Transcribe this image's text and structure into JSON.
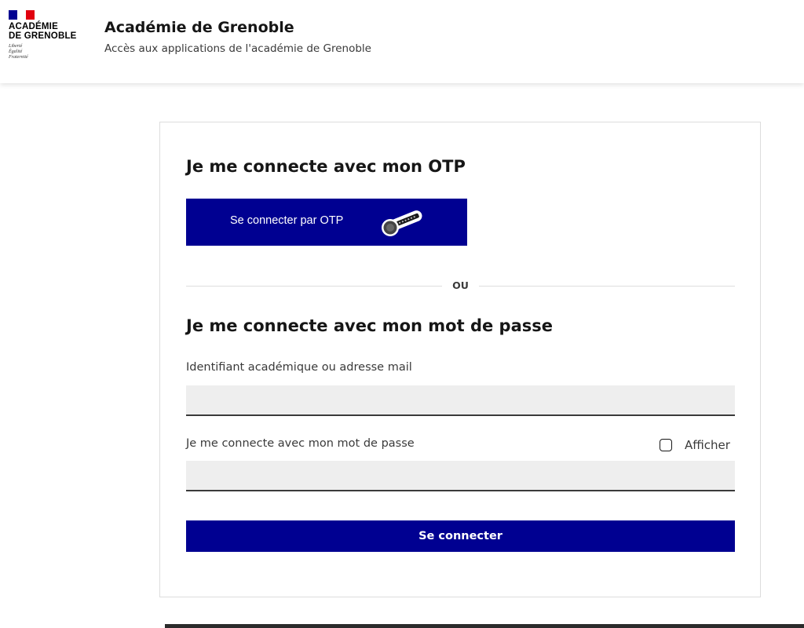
{
  "header": {
    "logo": {
      "line1": "ACADÉMIE",
      "line2": "DE GRENOBLE",
      "motto": [
        "Liberté",
        "Égalité",
        "Fraternité"
      ]
    },
    "title": "Académie de Grenoble",
    "subtitle": "Accès aux applications de l'académie de Grenoble"
  },
  "otp_section": {
    "title": "Je me connecte avec mon OTP",
    "button_label": "Se connecter par OTP",
    "icon": "otp-key-icon"
  },
  "separator": {
    "text": "OU"
  },
  "password_section": {
    "title": "Je me connecte avec mon mot de passe",
    "identifier_label": "Identifiant académique ou adresse mail",
    "identifier_value": "",
    "password_label": "Je me connecte avec mon mot de passe",
    "password_value": "",
    "show_label": "Afficher",
    "show_checked": false,
    "submit_label": "Se connecter"
  },
  "colors": {
    "primary": "#000091",
    "flag_blue": "#000091",
    "flag_red": "#e1000f",
    "input_background": "#eeeeee"
  }
}
